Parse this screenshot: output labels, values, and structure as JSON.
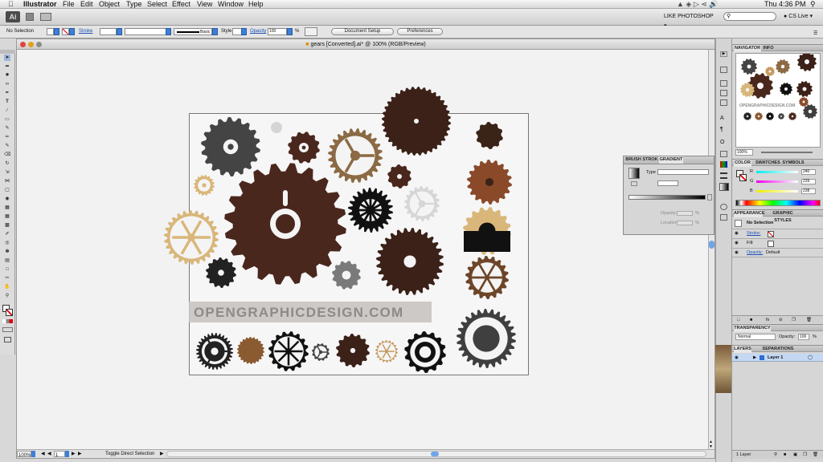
{
  "menubar": {
    "app_name": "Illustrator",
    "menus": [
      "File",
      "Edit",
      "Object",
      "Type",
      "Select",
      "Effect",
      "View",
      "Window",
      "Help"
    ],
    "clock": "Thu 4:36 PM"
  },
  "appbar": {
    "logo": "Ai",
    "workspace": "LIKE PHOTOSHOP",
    "cs_live": "CS Live"
  },
  "controlbar": {
    "selection": "No Selection",
    "stroke_label": "Stroke",
    "brush": "Basic",
    "style_label": "Style",
    "opacity_label": "Opacity",
    "opacity_value": "100",
    "opacity_unit": "%",
    "document_setup": "Document Setup",
    "preferences": "Preferences"
  },
  "document": {
    "title": "gears [Converted].ai* @ 100% (RGB/Preview)",
    "watermark": "OPENGRAPHICDESIGN.COM",
    "zoom": "100%",
    "page": "1",
    "status_text": "Toggle Direct Selection"
  },
  "navigator": {
    "tabs": [
      "NAVIGATOR",
      "INFO"
    ],
    "zoom": "100%"
  },
  "color_panel": {
    "tabs": [
      "COLOR",
      "SWATCHES",
      "SYMBOLS"
    ],
    "channels": [
      {
        "label": "R",
        "value": "240"
      },
      {
        "label": "G",
        "value": "239"
      },
      {
        "label": "B",
        "value": "238"
      }
    ]
  },
  "gradient_panel": {
    "tabs": [
      "BRUSH",
      "STROK",
      "GRADIENT"
    ],
    "type_label": "Type",
    "opacity_label": "Opacity:",
    "location_label": "Location:",
    "percent": "%"
  },
  "appearance_panel": {
    "tabs": [
      "APPEARANCE",
      "GRAPHIC STYLES"
    ],
    "title": "No Selection",
    "rows": [
      {
        "label": "Stroke:"
      },
      {
        "label": "Fill:"
      },
      {
        "label": "Opacity:",
        "value": "Default"
      }
    ]
  },
  "transparency_panel": {
    "tab": "TRANSPARENCY",
    "mode": "Normal",
    "opacity_label": "Opacity:",
    "opacity_value": "100",
    "unit": "%"
  },
  "layers_panel": {
    "tabs": [
      "LAYERS",
      "SEPARATIONS PREVIEW"
    ],
    "layer_name": "Layer 1",
    "footer": "1 Layer"
  },
  "colors": {
    "dark_brown": "#3b2118",
    "brown": "#4a271d",
    "tan": "#d9b67a",
    "gray": "#444444",
    "light_gray": "#d6d6d6",
    "mid_gray": "#7a7a7a"
  }
}
